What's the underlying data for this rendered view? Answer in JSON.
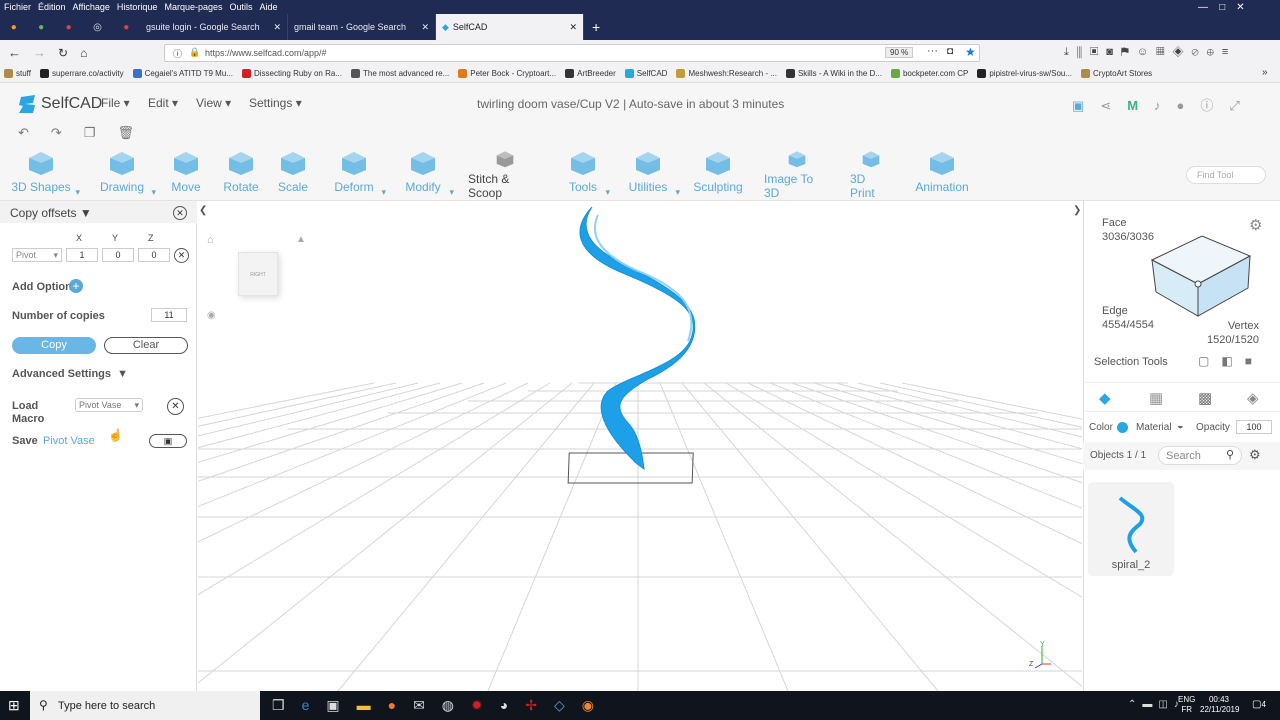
{
  "browser": {
    "menu": [
      "Fichier",
      "Édition",
      "Affichage",
      "Historique",
      "Marque-pages",
      "Outils",
      "Aide"
    ],
    "tabs": [
      {
        "label": "gsuite login - Google Search"
      },
      {
        "label": "gmail team - Google Search"
      },
      {
        "label": "SelfCAD",
        "active": true
      }
    ],
    "url": "https://www.selfcad.com/app/#",
    "zoom": "90 %",
    "bookmarks": [
      "stuff",
      "superrare.co/activity",
      "Cegaiel's ATITD T9 Mu...",
      "Dissecting Ruby on Ra...",
      "The most advanced re...",
      "Peter Bock - Cryptoart...",
      "ArtBreeder",
      "SelfCAD",
      "Meshwesh:Research - ...",
      "Skills - A Wiki in the D...",
      "bockpeter.com CP",
      "pipistrel-virus-sw/Sou...",
      "CryptoArt Stores"
    ]
  },
  "app": {
    "logo": "SelfCAD",
    "menus": [
      "File",
      "Edit",
      "View",
      "Settings"
    ],
    "doc_title": "twirling doom vase/Cup V2",
    "autosave": "Auto-save in about 3 minutes",
    "tools": [
      "3D Shapes",
      "Drawing",
      "Move",
      "Rotate",
      "Scale",
      "Deform",
      "Modify",
      "Stitch & Scoop",
      "Tools",
      "Utilities",
      "Sculpting",
      "Image To 3D",
      "3D Print",
      "Animation"
    ],
    "find_placeholder": "Find Tool"
  },
  "panel": {
    "title": "Copy offsets",
    "axes": [
      "X",
      "Y",
      "Z"
    ],
    "pivot": "Pivot",
    "offsets": [
      "1",
      "0",
      "0"
    ],
    "add_option": "Add Option",
    "num_copies_label": "Number of copies",
    "num_copies": "11",
    "copy": "Copy",
    "clear": "Clear",
    "advanced": "Advanced Settings",
    "load_macro": "Load\nMacro",
    "macro_value": "Pivot Vase",
    "save": "Save",
    "save_name": "Pivot Vase"
  },
  "viewcube": {
    "label": "RIGHT"
  },
  "right": {
    "face_label": "Face",
    "face": "3036/3036",
    "edge_label": "Edge",
    "edge": "4554/4554",
    "vertex_label": "Vertex",
    "vertex": "1520/1520",
    "selection_tools": "Selection Tools",
    "color": "Color",
    "material": "Material",
    "opacity": "Opacity",
    "opacity_value": "100",
    "objects": "Objects 1 / 1",
    "search": "Search",
    "object_name": "spiral_2"
  },
  "taskbar": {
    "search": "Type here to search",
    "lang1": "ENG",
    "lang2": "FR",
    "time": "00:43",
    "date": "22/11/2019",
    "notif": "4"
  },
  "colors": {
    "accent": "#2aa6e0",
    "spiral": "#1ea0e8",
    "titlebar": "#1f2b52"
  }
}
